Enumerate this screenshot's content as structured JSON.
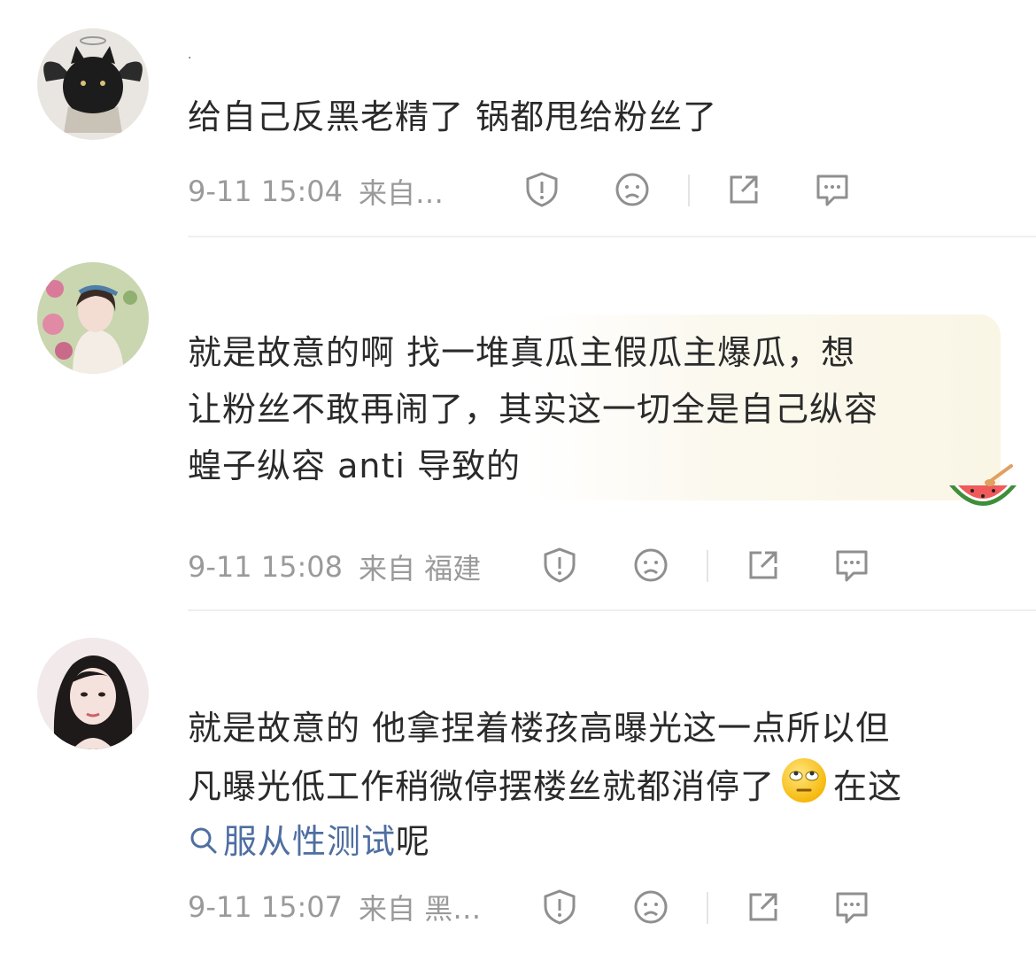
{
  "comments": [
    {
      "name": "·",
      "text": "给自己反黑老精了 锅都甩给粉丝了",
      "time": "9-11 15:04",
      "source": "来自…"
    },
    {
      "text_line1": "就是故意的啊 找一堆真瓜主假瓜主爆瓜，想",
      "text_line2": "让粉丝不敢再闹了，其实这一切全是自己纵容",
      "text_line3": "蝗子纵容 anti 导致的",
      "time": "9-11 15:08",
      "source": "来自 福建",
      "badge": "watermelon"
    },
    {
      "text_line1": "就是故意的 他拿捏着楼孩高曝光这一点所以但",
      "text_line2a": "凡曝光低工作稍微停摆楼丝就都消停了",
      "text_line2b": "在这",
      "topic": "服从性测试",
      "text_line3_after": "呢",
      "time": "9-11 15:07",
      "source": "来自 黑…"
    }
  ],
  "icons": [
    "report-icon",
    "dislike-face-icon",
    "share-icon",
    "comment-icon",
    "search-icon",
    "rolling-eyes-emoji"
  ],
  "colors": {
    "text": "#2a2a2a",
    "meta": "#9a9a9a",
    "topic": "#4f6ea1",
    "icon": "#8f8f8f"
  }
}
